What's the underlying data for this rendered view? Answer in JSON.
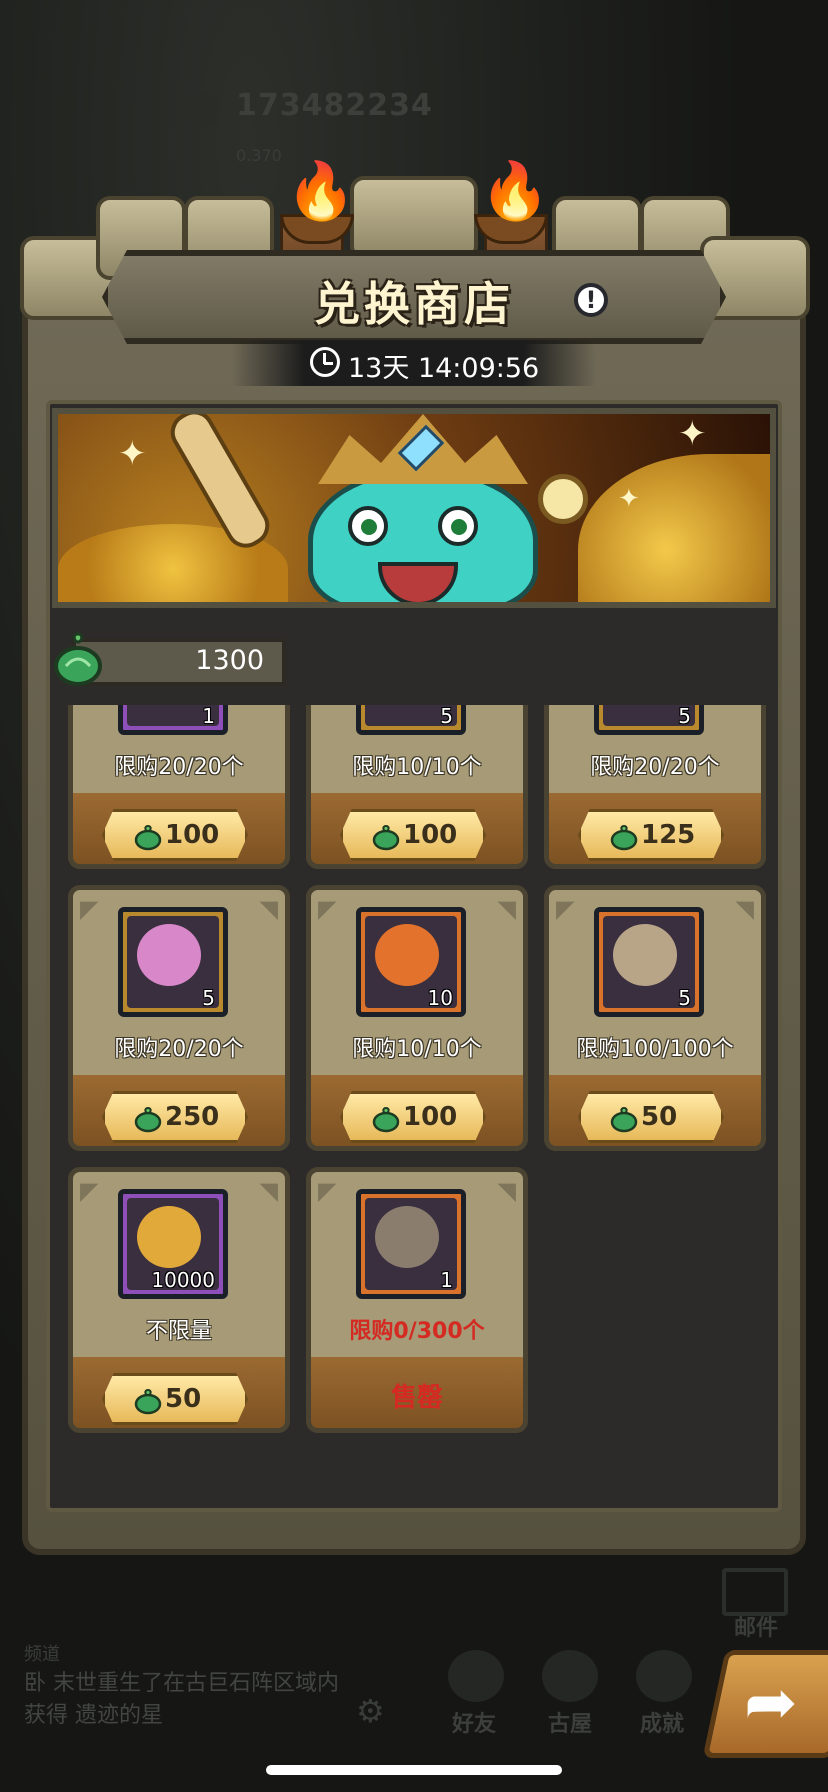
{
  "background": {
    "player_id": "173482234",
    "player_level": "0.370",
    "mail_label": "邮件",
    "chat_title": "频道",
    "chat_message": "卧 末世重生了在古巨石阵区域内获得 遗迹的星",
    "nav": [
      "好友",
      "古屋",
      "成就"
    ]
  },
  "shop": {
    "title": "兑换商店",
    "timer": "13天 14:09:56",
    "currency_amount": "1300",
    "items": [
      {
        "count": "1",
        "limit": "限购20/20个",
        "price": "100",
        "sold_out": false,
        "color": "#8e4fb8",
        "art": "#c9a24a"
      },
      {
        "count": "5",
        "limit": "限购10/10个",
        "price": "100",
        "sold_out": false,
        "color": "#b98a2d",
        "art": "#e46a2a"
      },
      {
        "count": "5",
        "limit": "限购20/20个",
        "price": "125",
        "sold_out": false,
        "color": "#b98a2d",
        "art": "#6a5fa8"
      },
      {
        "count": "5",
        "limit": "限购20/20个",
        "price": "250",
        "sold_out": false,
        "color": "#b98a2d",
        "art": "#d888c9"
      },
      {
        "count": "10",
        "limit": "限购10/10个",
        "price": "100",
        "sold_out": false,
        "color": "#d9722a",
        "art": "#e2722c"
      },
      {
        "count": "5",
        "limit": "限购100/100个",
        "price": "50",
        "sold_out": false,
        "color": "#d9722a",
        "art": "#b8a487"
      },
      {
        "count": "10000",
        "limit": "不限量",
        "price": "50",
        "sold_out": false,
        "color": "#8e4fb8",
        "art": "#e1a93a"
      },
      {
        "count": "1",
        "limit": "限购0/300个",
        "price": "",
        "sold_out": true,
        "sold_out_label": "售罄",
        "color": "#d9722a",
        "art": "#8a7d6e"
      }
    ]
  },
  "colors": {
    "sold_out_red": "#d42a22",
    "gem_green": "#3aa55a",
    "card_tan": "#a69a77"
  }
}
